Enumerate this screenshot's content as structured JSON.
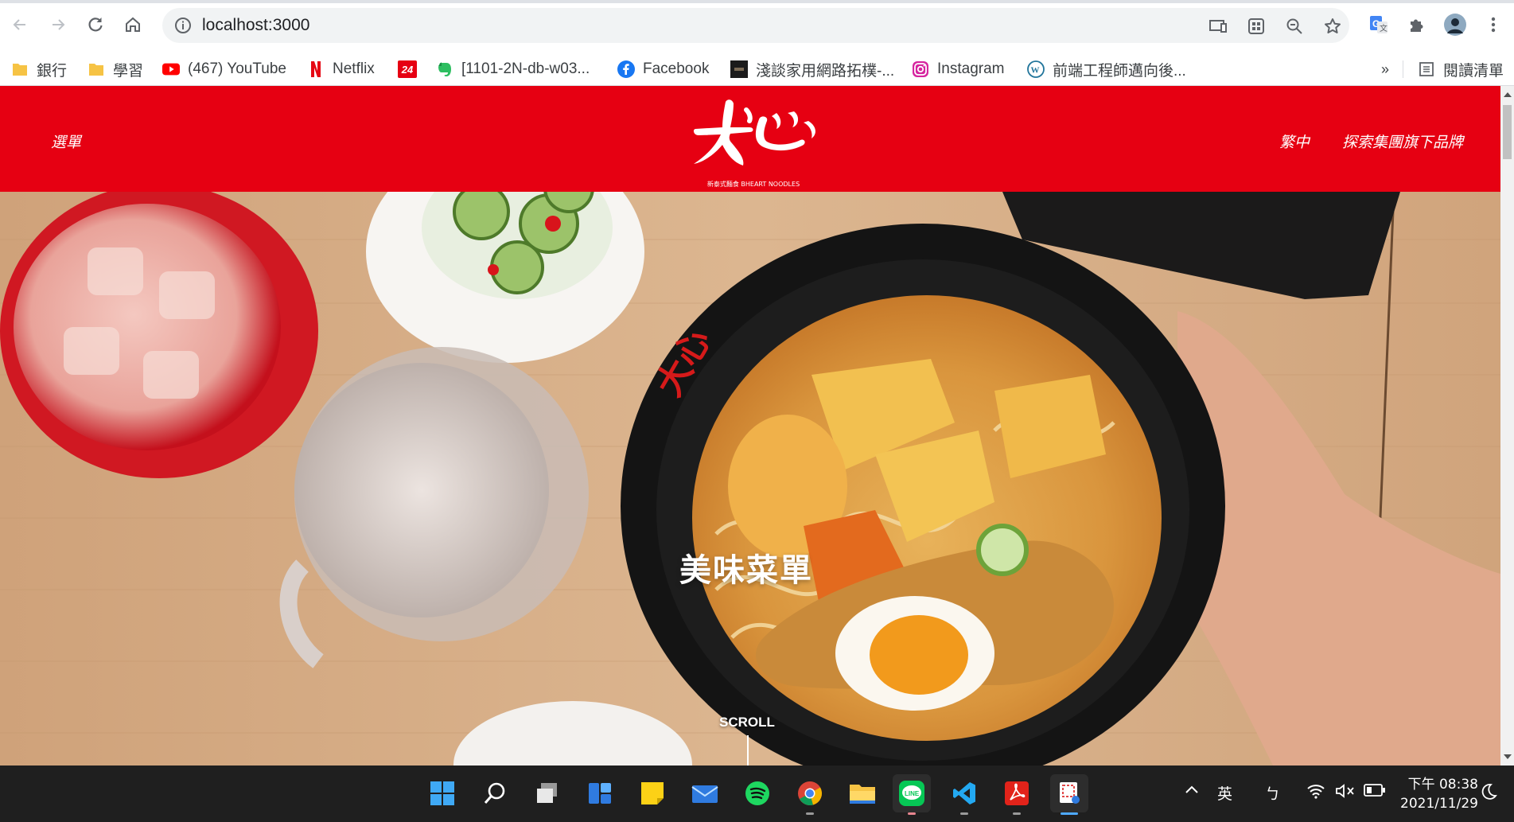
{
  "browser": {
    "url": "localhost:3000",
    "bookmarks": [
      {
        "label": "銀行",
        "icon": "folder-icon"
      },
      {
        "label": "學習",
        "icon": "folder-icon"
      },
      {
        "label": "(467) YouTube",
        "icon": "youtube-icon"
      },
      {
        "label": "Netflix",
        "icon": "netflix-icon"
      },
      {
        "label": "",
        "icon": "24-icon",
        "badge": "24"
      },
      {
        "label": "[1101-2N-db-w03...",
        "icon": "evernote-icon"
      },
      {
        "label": "Facebook",
        "icon": "facebook-icon"
      },
      {
        "label": "淺談家用網路拓樸-...",
        "icon": "bookmark-dark-icon"
      },
      {
        "label": "Instagram",
        "icon": "instagram-icon"
      },
      {
        "label": "前端工程師邁向後...",
        "icon": "wordpress-icon"
      }
    ],
    "more_bookmarks": "»",
    "reading_list": "閱讀清單"
  },
  "site": {
    "menu_label": "選單",
    "logo_tagline": "新泰式麵食 BHEART NOODLES",
    "lang_label": "繁中",
    "brands_label": "探索集團旗下品牌",
    "hero_title": "美味菜單",
    "scroll_label": "SCROLL"
  },
  "taskbar": {
    "apps": [
      "windows-start-icon",
      "search-icon",
      "task-view-icon",
      "widgets-icon",
      "sticky-notes-icon",
      "mail-icon",
      "spotify-icon",
      "chrome-icon",
      "file-explorer-icon",
      "line-icon",
      "vscode-icon",
      "acrobat-icon",
      "snipping-tool-icon"
    ],
    "ime_label": "英",
    "ime_mode": "ㄅ",
    "time": "下午 08:38",
    "date": "2021/11/29"
  },
  "colors": {
    "brand_red": "#e60012",
    "taskbar": "#1f1f1f"
  }
}
